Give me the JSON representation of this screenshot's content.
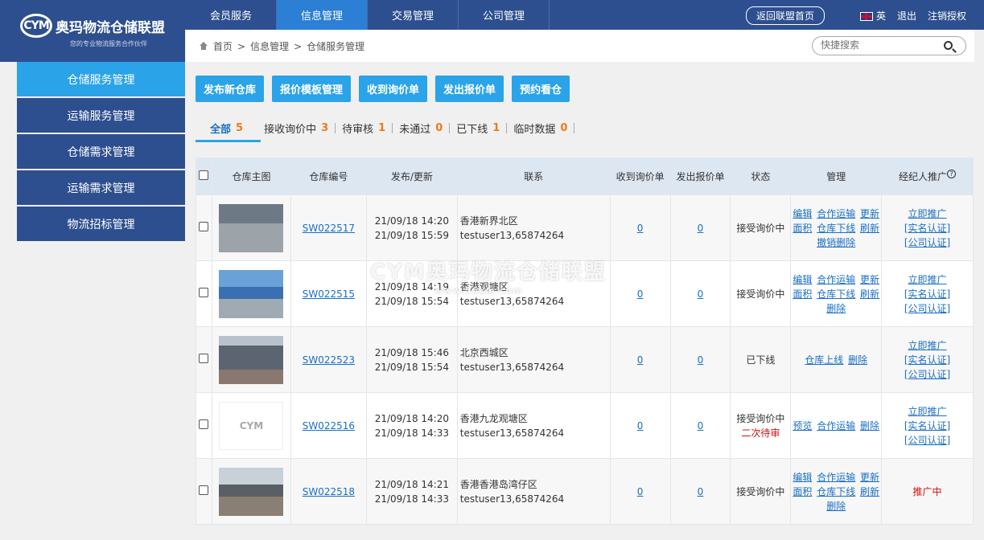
{
  "logo": {
    "mark": "CYM",
    "name": "奥玛物流仓储联盟",
    "slogan": "您的专业物流服务合作伙伴"
  },
  "topnav": [
    "会员服务",
    "信息管理",
    "交易管理",
    "公司管理"
  ],
  "top_right": {
    "back": "返回联盟首页",
    "lang": "英",
    "logout": "退出",
    "license": "注销授权"
  },
  "breadcrumb": {
    "home": "首页",
    "sep": ">",
    "level1": "信息管理",
    "level2": "仓储服务管理"
  },
  "search": {
    "placeholder": "快捷搜索"
  },
  "sidebar": [
    "仓储服务管理",
    "运输服务管理",
    "仓储需求管理",
    "运输需求管理",
    "物流招标管理"
  ],
  "actions": [
    "发布新仓库",
    "报价模板管理",
    "收到询价单",
    "发出报价单",
    "预约看仓"
  ],
  "tabs": [
    {
      "label": "全部",
      "count": "5"
    },
    {
      "label": "接收询价中",
      "count": "3"
    },
    {
      "label": "待审核",
      "count": "1"
    },
    {
      "label": "未通过",
      "count": "0"
    },
    {
      "label": "已下线",
      "count": "1"
    },
    {
      "label": "临时数据",
      "count": "0"
    }
  ],
  "table": {
    "headers": [
      "仓库主图",
      "仓库编号",
      "发布/更新",
      "联系",
      "收到询价单",
      "发出报价单",
      "状态",
      "管理",
      "经纪人推广"
    ],
    "rows": [
      {
        "id": "SW022517",
        "published": "21/09/18 14:20",
        "updated": "21/09/18 15:59",
        "area": "香港新界北区",
        "contact": "testuser13,65874264",
        "received": "0",
        "sent": "0",
        "status": "接受询价中",
        "status2": "",
        "ops": [
          "编辑",
          "合作运输",
          "更新",
          "面积",
          "仓库下线",
          "刷新",
          "撤销删除"
        ],
        "promo": [
          "立即推广",
          "[实名认证]",
          "[公司认证]"
        ]
      },
      {
        "id": "SW022515",
        "published": "21/09/18 14:19",
        "updated": "21/09/18 15:54",
        "area": "香港观塘区",
        "contact": "testuser13,65874264",
        "received": "0",
        "sent": "0",
        "status": "接受询价中",
        "status2": "",
        "ops": [
          "编辑",
          "合作运输",
          "更新",
          "面积",
          "仓库下线",
          "刷新",
          "删除"
        ],
        "promo": [
          "立即推广",
          "[实名认证]",
          "[公司认证]"
        ]
      },
      {
        "id": "SW022523",
        "published": "21/09/18 15:46",
        "updated": "21/09/18 15:54",
        "area": "北京西城区",
        "contact": "testuser13,65874264",
        "received": "0",
        "sent": "0",
        "status": "已下线",
        "status2": "",
        "ops": [
          "仓库上线",
          "删除"
        ],
        "promo": [
          "立即推广",
          "[实名认证]",
          "[公司认证]"
        ]
      },
      {
        "id": "SW022516",
        "published": "21/09/18 14:20",
        "updated": "21/09/18 14:33",
        "area": "香港九龙观塘区",
        "contact": "testuser13,65874264",
        "received": "0",
        "sent": "0",
        "status": "接受询价中",
        "status2": "二次待审",
        "ops": [
          "预览",
          "合作运输",
          "删除"
        ],
        "promo": [
          "立即推广",
          "[实名认证]",
          "[公司认证]"
        ]
      },
      {
        "id": "SW022518",
        "published": "21/09/18 14:21",
        "updated": "21/09/18 14:33",
        "area": "香港香港岛湾仔区",
        "contact": "testuser13,65874264",
        "received": "0",
        "sent": "0",
        "status": "接受询价中",
        "status2": "",
        "ops": [
          "编辑",
          "合作运输",
          "更新",
          "面积",
          "仓库下线",
          "刷新",
          "删除"
        ],
        "promo": [
          "推广中"
        ]
      }
    ]
  },
  "watermark": {
    "title": "CYM奥玛物流仓储联盟",
    "sub": "www.56Lm.com"
  }
}
